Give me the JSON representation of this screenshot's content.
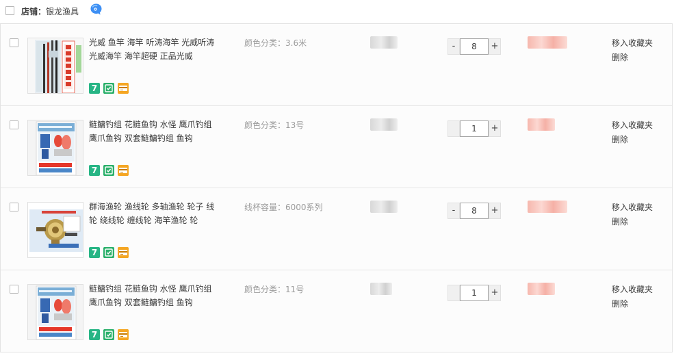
{
  "shop": {
    "label": "店铺：",
    "name": "银龙渔具"
  },
  "badge_7": "7",
  "items": [
    {
      "title": "光威 鱼竿 海竿 听涛海竿 光威听涛光威海竿 海竿超硬 正品光威",
      "sku": "颜色分类：3.6米",
      "qty": "8",
      "move_label": "移入收藏夹",
      "delete_label": "删除"
    },
    {
      "title": "鲢鳙钓组 花鲢鱼钩 水怪 鹰爪钓组 鹰爪鱼钩 双套鲢鳙钓组 鱼钩",
      "sku": "颜色分类：13号",
      "qty": "1",
      "move_label": "移入收藏夹",
      "delete_label": "删除"
    },
    {
      "title": "群海渔轮 渔线轮 多轴渔轮 轮子 线轮 绕线轮 缠线轮 海竿渔轮 轮",
      "sku": "线杯容量：6000系列",
      "qty": "8",
      "move_label": "移入收藏夹",
      "delete_label": "删除"
    },
    {
      "title": "鲢鳙钓组 花鲢鱼钩 水怪 鹰爪钓组 鹰爪鱼钩 双套鲢鳙钓组 鱼钩",
      "sku": "颜色分类：11号",
      "qty": "1",
      "move_label": "移入收藏夹",
      "delete_label": "删除"
    }
  ],
  "qty_controls": {
    "minus": "-",
    "plus": "+"
  },
  "colors": {
    "badge_green": "#27b585",
    "badge_orange": "#f5a623",
    "price_blur": "#f6b7ad"
  }
}
